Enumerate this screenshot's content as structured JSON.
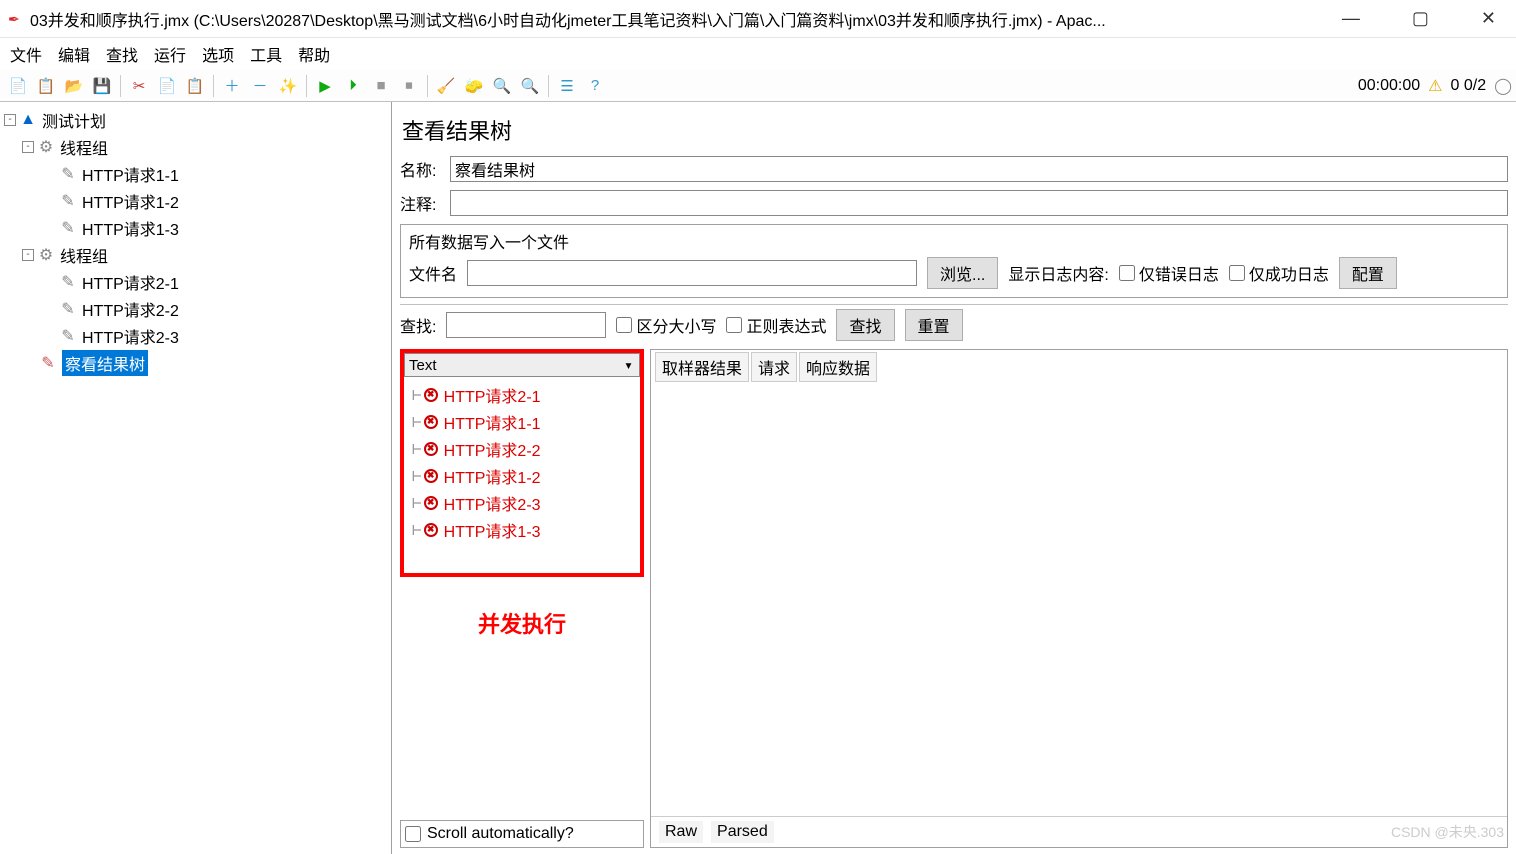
{
  "window": {
    "title": "03并发和顺序执行.jmx (C:\\Users\\20287\\Desktop\\黑马测试文档\\6小时自动化jmeter工具笔记资料\\入门篇\\入门篇资料\\jmx\\03并发和顺序执行.jmx) - Apac..."
  },
  "menu": [
    "文件",
    "编辑",
    "查找",
    "运行",
    "选项",
    "工具",
    "帮助"
  ],
  "toolbar_right": {
    "timer": "00:00:00",
    "count": "0 0/2"
  },
  "tree": [
    {
      "depth": 0,
      "toggle": "-",
      "icon": "plan",
      "label": "测试计划"
    },
    {
      "depth": 1,
      "toggle": "-",
      "icon": "thread",
      "label": "线程组"
    },
    {
      "depth": 2,
      "icon": "http",
      "label": "HTTP请求1-1"
    },
    {
      "depth": 2,
      "icon": "http",
      "label": "HTTP请求1-2"
    },
    {
      "depth": 2,
      "icon": "http",
      "label": "HTTP请求1-3"
    },
    {
      "depth": 1,
      "toggle": "-",
      "icon": "thread",
      "label": "线程组"
    },
    {
      "depth": 2,
      "icon": "http",
      "label": "HTTP请求2-1"
    },
    {
      "depth": 2,
      "icon": "http",
      "label": "HTTP请求2-2"
    },
    {
      "depth": 2,
      "icon": "http",
      "label": "HTTP请求2-3"
    },
    {
      "depth": "1b",
      "icon": "results",
      "label": "察看结果树",
      "selected": true
    }
  ],
  "panel": {
    "title": "查看结果树",
    "name_label": "名称:",
    "name_value": "察看结果树",
    "comment_label": "注释:",
    "file_legend": "所有数据写入一个文件",
    "filename_label": "文件名",
    "browse": "浏览...",
    "show_log": "显示日志内容:",
    "errors_only": "仅错误日志",
    "success_only": "仅成功日志",
    "configure": "配置",
    "search_label": "查找:",
    "case_sensitive": "区分大小写",
    "regex": "正则表达式",
    "search_btn": "查找",
    "reset_btn": "重置",
    "renderer": "Text",
    "tabs": [
      "取样器结果",
      "请求",
      "响应数据"
    ],
    "raw": "Raw",
    "parsed": "Parsed",
    "scroll_auto": "Scroll automatically?"
  },
  "results": [
    "HTTP请求2-1",
    "HTTP请求1-1",
    "HTTP请求2-2",
    "HTTP请求1-2",
    "HTTP请求2-3",
    "HTTP请求1-3"
  ],
  "annotation": "并发执行",
  "watermark": "CSDN @未央.303"
}
